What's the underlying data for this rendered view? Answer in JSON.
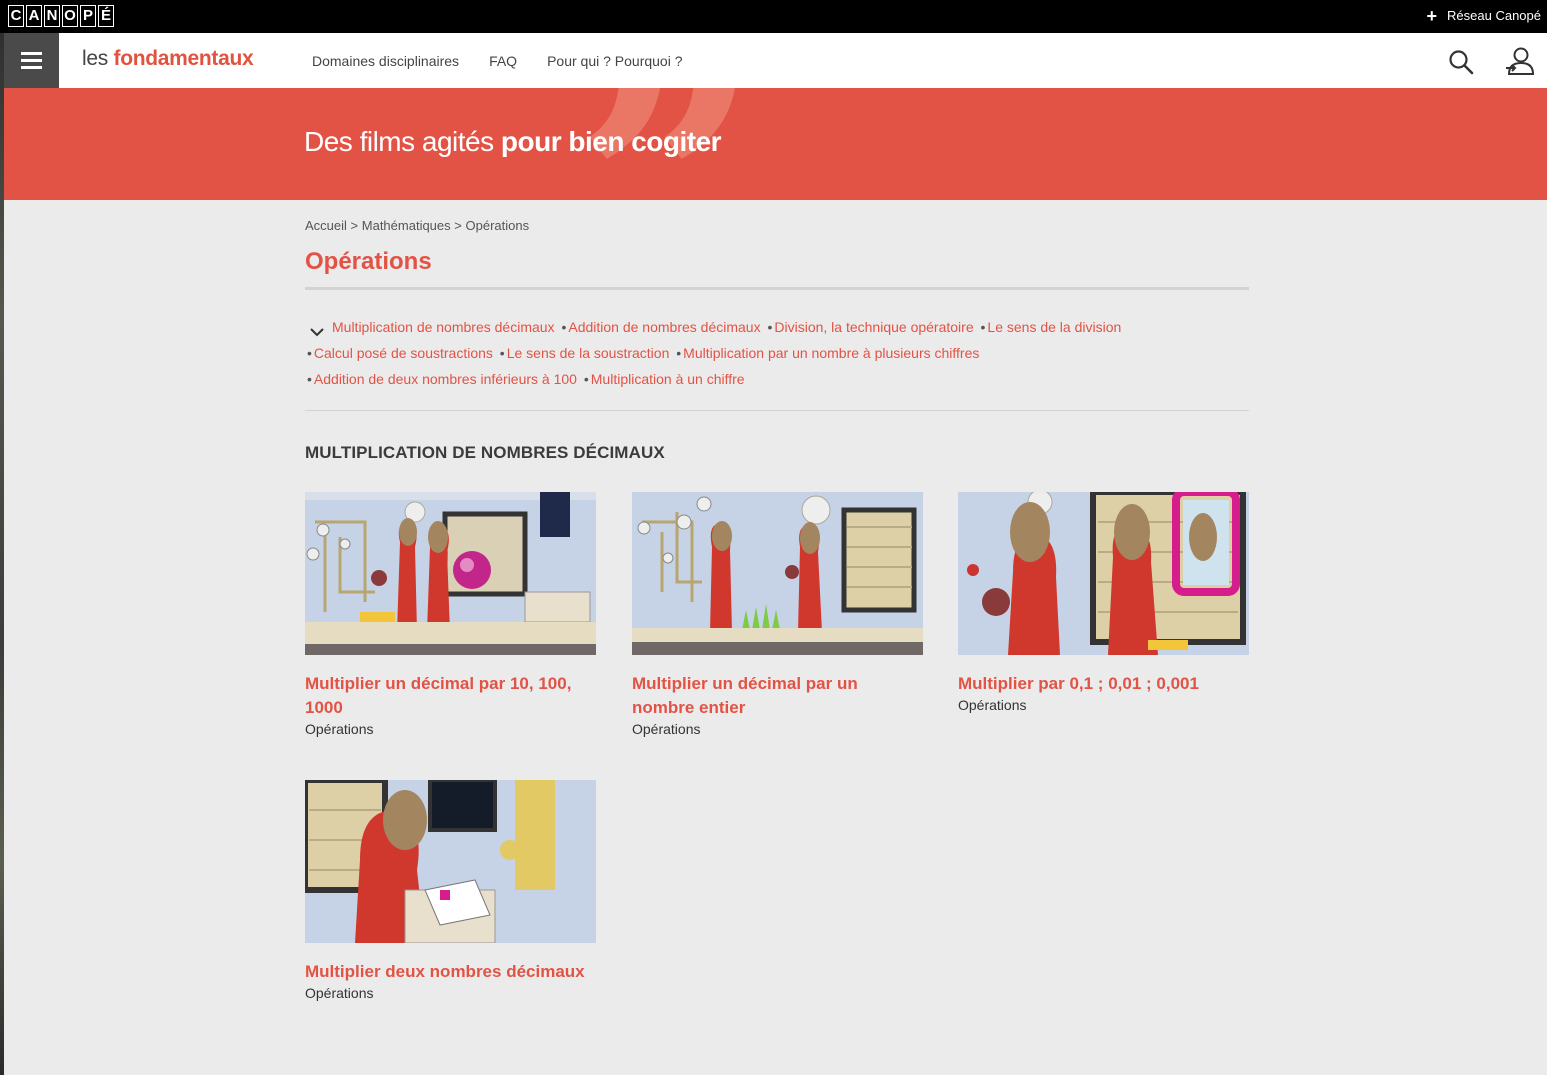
{
  "topbar": {
    "logo_letters": [
      "C",
      "A",
      "N",
      "O",
      "P",
      "É"
    ],
    "network_link": "Réseau Canopé",
    "plus_icon": "plus-icon"
  },
  "header": {
    "brand_prefix": "les",
    "brand_name": "fondamentaux",
    "nav": [
      "Domaines disciplinaires",
      "FAQ",
      "Pour qui ? Pourquoi ?"
    ],
    "icons": [
      "menu-icon",
      "search-icon",
      "user-icon"
    ]
  },
  "banner": {
    "tagline_regular": "Des films agités",
    "tagline_bold": "pour bien cogiter"
  },
  "breadcrumb": {
    "items": [
      "Accueil",
      "Mathématiques",
      "Opérations"
    ],
    "separator": ">"
  },
  "page_title": "Opérations",
  "chapters": [
    "Multiplication de nombres décimaux",
    "Addition de nombres décimaux",
    "Division, la technique opératoire",
    "Le sens de la division",
    "Calcul posé de soustractions",
    "Le sens de la soustraction",
    "Multiplication par un nombre à plusieurs chiffres",
    "Addition de deux nombres inférieurs à 100",
    "Multiplication à un chiffre"
  ],
  "section_title": "MULTIPLICATION DE NOMBRES DÉCIMAUX",
  "cards": [
    {
      "title": "Multiplier un décimal par 10, 100, 1000",
      "tag": "Opérations"
    },
    {
      "title": "Multiplier un décimal par un nombre entier",
      "tag": "Opérations"
    },
    {
      "title": "Multiplier par 0,1 ; 0,01 ; 0,001",
      "tag": "Opérations"
    },
    {
      "title": "Multiplier deux nombres décimaux",
      "tag": "Opérations"
    }
  ],
  "colors": {
    "accent": "#e25345",
    "banner": "#e25345",
    "page_bg": "#ebebeb",
    "menu_button": "#4a4a4a"
  }
}
